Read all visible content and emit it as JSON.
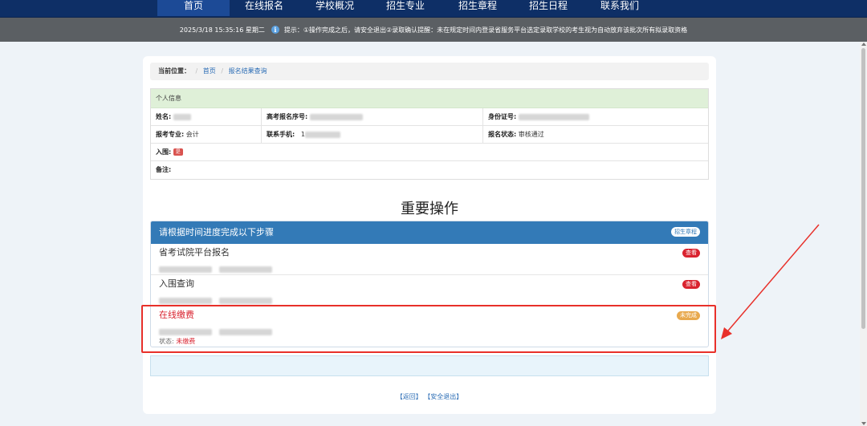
{
  "nav": {
    "items": [
      "首页",
      "在线报名",
      "学校概况",
      "招生专业",
      "招生章程",
      "招生日程",
      "联系我们"
    ],
    "active_index": 0
  },
  "notice": {
    "datetime": "2025/3/18 15:35:16 星期二",
    "text": "提示：①操作完成之后，请安全退出②录取确认提醒：未在规定时间内登录省服务平台选定录取学校的考生视为自动放弃该批次所有拟录取资格"
  },
  "breadcrumb": {
    "label": "当前位置：",
    "home": "首页",
    "current": "报名结果查询"
  },
  "personal": {
    "heading": "个人信息",
    "name_label": "姓名:",
    "exam_no_label": "高考报名序号:",
    "id_label": "身份证号:",
    "major_label": "报考专业:",
    "major_value": "会计",
    "phone_label": "联系手机:",
    "phone_prefix": "1",
    "status_label": "报名状态:",
    "status_value": "审核通过",
    "shortlist_label": "入围:",
    "shortlist_tag": "是",
    "remark_label": "备注:"
  },
  "section_title": "重要操作",
  "steps": {
    "heading": "请根据时间进度完成以下步骤",
    "heading_badge": "招生章程",
    "items": [
      {
        "title": "省考试院平台报名",
        "badge": "查看"
      },
      {
        "title": "入围查询",
        "badge": "查看"
      },
      {
        "title": "在线缴费",
        "badge": "未完成",
        "status_label": "状态:",
        "status_value": "未缴费"
      }
    ]
  },
  "footer": {
    "back": "【返回】",
    "logout": "【安全退出】"
  },
  "colors": {
    "nav_bg": "#0e2f66",
    "panel_heading": "#337ab7",
    "alert_red": "#d9232f",
    "annotation": "#e8302a"
  }
}
